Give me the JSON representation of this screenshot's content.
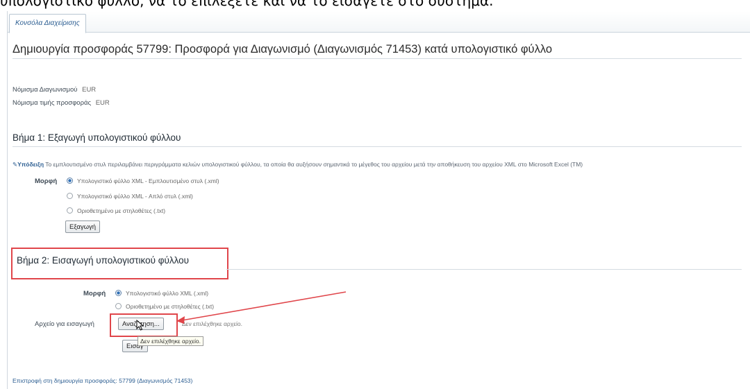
{
  "caption": "υπολογιστικό φύλλο, να το επιλέξετε και να το εισάγετε στο σύστημα.",
  "tab": {
    "label": "Κονσόλα Διαχείρισης"
  },
  "page": {
    "title": "Δημιουργία προσφοράς 57799: Προσφορά για Διαγωνισμό (Διαγωνισμός 71453) κατά υπολογιστικό φύλλο",
    "currency_tender_label": "Νόμισμα Διαγωνισμού",
    "currency_tender_value": "EUR",
    "currency_bid_label": "Νόμισμα τιμής προσφοράς",
    "currency_bid_value": "EUR"
  },
  "step1": {
    "heading": "Βήμα 1: Εξαγωγή υπολογιστικού φύλλου",
    "tip_label": "Υπόδειξη",
    "tip_text": "Το εμπλουτισμένο στυλ περιλαμβάνει περιγράμματα κελιών υπολογιστικού φύλλου, τα οποία θα αυξήσουν σημαντικά το μέγεθος του αρχείου μετά την αποθήκευση του αρχείου XML στο Microsoft Excel (TM)",
    "format_label": "Μορφή",
    "options": [
      "Υπολογιστικό φύλλο XML - Εμπλουτισμένο στυλ (.xml)",
      "Υπολογιστικό φύλλο XML - Απλό στυλ (.xml)",
      "Οριοθετημένο με στηλοθέτες (.txt)"
    ],
    "export_button": "Εξαγωγή"
  },
  "step2": {
    "heading": "Βήμα 2: Εισαγωγή υπολογιστικού φύλλου",
    "format_label": "Μορφή",
    "options": [
      "Υπολογιστικό φύλλο XML (.xml)",
      "Οριοθετημένο με στηλοθέτες (.txt)"
    ],
    "file_label": "Αρχείο για εισαγωγή",
    "browse_button": "Αναζήτηση...",
    "file_status": "Δεν επιλέχθηκε αρχείο.",
    "import_button": "Εισαγ",
    "tooltip": "Δεν επιλέχθηκε αρχείο."
  },
  "footer": {
    "back_link": "Επιστροφή στη δημιουργία προσφοράς: 57799 (Διαγωνισμός 71453)"
  },
  "colors": {
    "highlight": "#e0454a",
    "link": "#2b5d91"
  }
}
